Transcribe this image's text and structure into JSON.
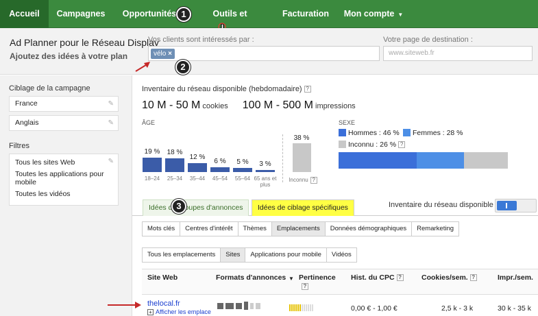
{
  "topnav": {
    "items": [
      {
        "label": "Accueil"
      },
      {
        "label": "Campagnes"
      },
      {
        "label": "Opportunités"
      },
      {
        "label": "Outils et analyses"
      },
      {
        "label": "Facturation"
      },
      {
        "label": "Mon compte"
      }
    ]
  },
  "callouts": [
    "1",
    "2",
    "3"
  ],
  "header": {
    "title": "Ad Planner pour le Réseau Display",
    "subtitle": "Ajoutez des idées à votre plan",
    "clients_label": "Vos clients sont intéressés par :",
    "clients_tag": "vélo",
    "tag_close": "×",
    "destination_label": "Votre page de destination :",
    "destination_placeholder": "www.siteweb.fr"
  },
  "sidebar": {
    "targeting_heading": "Ciblage de la campagne",
    "country": "France",
    "language": "Anglais",
    "filters_heading": "Filtres",
    "filters": [
      "Tous les sites Web",
      "Toutes les applications pour mobile",
      "Toutes les vidéos"
    ]
  },
  "inventory": {
    "label": "Inventaire du réseau disponible (hebdomadaire)",
    "cookies_value": "10 M - 50 M",
    "cookies_unit": "cookies",
    "impressions_value": "100 M - 500 M",
    "impressions_unit": "impressions"
  },
  "chart_data": {
    "type": "bar",
    "title": "ÂGE",
    "categories": [
      "18–24",
      "25–34",
      "35–44",
      "45–54",
      "55–64",
      "65 ans et plus"
    ],
    "values": [
      19,
      18,
      12,
      6,
      5,
      3
    ],
    "value_labels": [
      "19 %",
      "18 %",
      "12 %",
      "6 %",
      "5 %",
      "3 %"
    ],
    "unknown": {
      "label": "Inconnu",
      "value": 38,
      "value_label": "38 %"
    },
    "ylim": [
      0,
      40
    ]
  },
  "gender": {
    "heading": "SEXE",
    "men_label": "Hommes : 46 %",
    "women_label": "Femmes : 28 %",
    "unknown_label": "Inconnu : 26 %",
    "men": 46,
    "women": 28,
    "unknown": 26,
    "colors": {
      "men": "#3b6fd9",
      "women": "#4d8fe6",
      "unknown": "#c8c8c8"
    }
  },
  "tabs": {
    "ad_formats": "Idées de groupes d'annonces",
    "targeting": "Idées de ciblage spécifiques",
    "inventory_toggle_label": "Inventaire du réseau disponible :"
  },
  "subtabs1": [
    "Mots clés",
    "Centres d'intérêt",
    "Thèmes",
    "Emplacements",
    "Données démographiques",
    "Remarketing"
  ],
  "subtabs2": [
    "Tous les emplacements",
    "Sites",
    "Applications pour mobile",
    "Vidéos"
  ],
  "table": {
    "headers": {
      "site": "Site Web",
      "formats": "Formats d'annonces",
      "relevance": "Pertinence",
      "cpc": "Hist. du CPC",
      "cookies": "Cookies/sem.",
      "impr": "Impr./sem."
    },
    "row": {
      "site": "thelocal.fr",
      "show_more": "Afficher les emplace",
      "cpc": "0,00 € - 1,00 €",
      "cookies": "2,5 k - 3 k",
      "impr": "30 k - 35 k"
    }
  },
  "colors": {
    "nav_green": "#3b8a3e",
    "highlight_yellow": "#ffff44",
    "annotation_red": "#c62828",
    "bar_blue": "#3b5ca8"
  }
}
